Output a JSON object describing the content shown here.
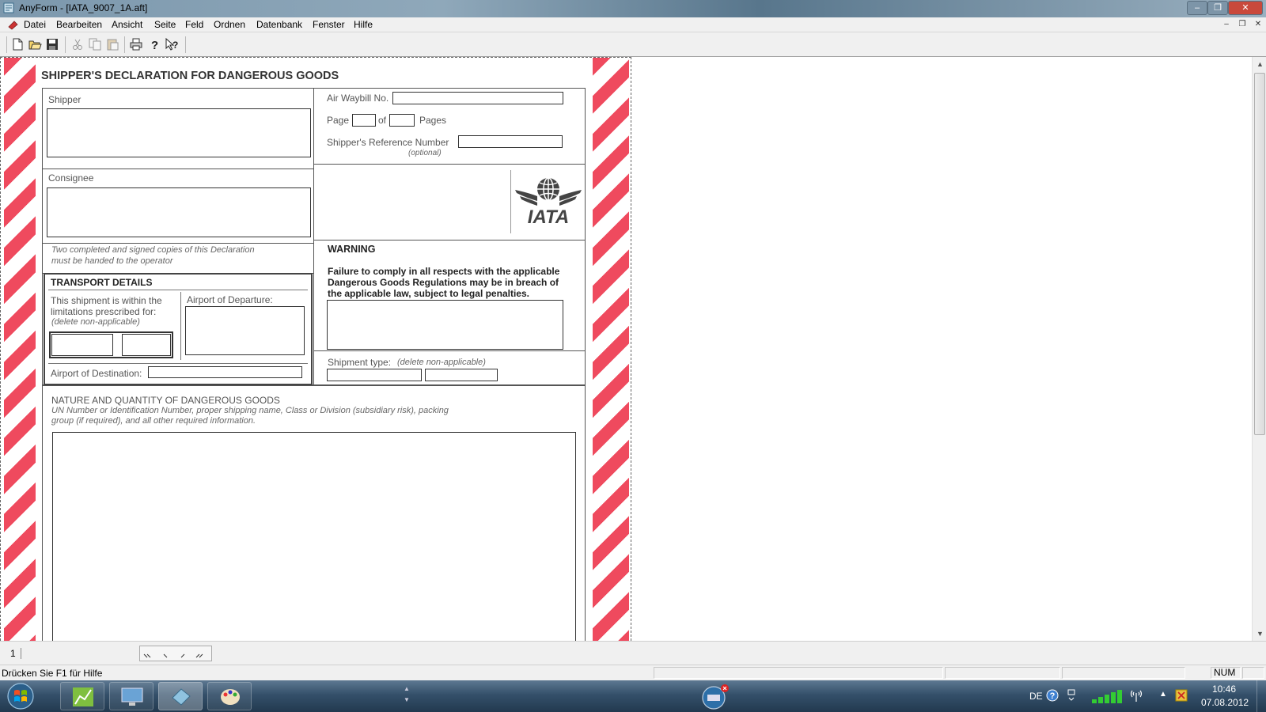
{
  "window": {
    "title": "AnyForm - [IATA_9007_1A.aft]",
    "controls": [
      "–",
      "❐",
      "✕"
    ]
  },
  "menu": {
    "items": [
      "Datei",
      "Bearbeiten",
      "Ansicht",
      "Seite",
      "Feld",
      "Ordnen",
      "Datenbank",
      "Fenster",
      "Hilfe"
    ],
    "mdi_controls": [
      "–",
      "❐",
      "✕"
    ]
  },
  "toolbar": {
    "buttons": [
      "new-icon",
      "open-icon",
      "save-icon",
      "cut-icon",
      "copy-icon",
      "paste-icon",
      "print-icon",
      "help-icon",
      "context-help-icon"
    ],
    "context_help_label": "?"
  },
  "form": {
    "title": "SHIPPER'S DECLARATION FOR DANGEROUS GOODS",
    "shipper_label": "Shipper",
    "consignee_label": "Consignee",
    "air_waybill_label": "Air Waybill No.",
    "page_label": "Page",
    "of_label": "of",
    "pages_label": "Pages",
    "shipper_ref_label": "Shipper's Reference Number",
    "optional_label": "(optional)",
    "copies_note_line1": "Two completed and signed copies of this Declaration",
    "copies_note_line2": "must be handed to the operator",
    "transport_title": "TRANSPORT DETAILS",
    "limits_line1": "This shipment is within the",
    "limits_line2": "limitations prescribed for:",
    "delete_note": "(delete non-applicable)",
    "airport_departure_label": "Airport of Departure:",
    "airport_destination_label": "Airport of Destination:",
    "warning_title": "WARNING",
    "warning_line1": "Failure to comply in all respects with the applicable",
    "warning_line2": "Dangerous Goods Regulations may be in breach of",
    "warning_line3": "the applicable law, subject to legal penalties.",
    "shipment_type_label": "Shipment type:",
    "shipment_type_note": "(delete non-applicable)",
    "nature_title": "NATURE AND QUANTITY OF DANGEROUS GOODS",
    "nature_line1": "UN Number or Identification Number, proper shipping name, Class or Division (subsidiary risk), packing",
    "nature_line2": "group (if required), and all other required information.",
    "logo_text": "IATA"
  },
  "pagestrip": {
    "current_page": "1",
    "nav_buttons": [
      "first-page",
      "previous-page",
      "next-page",
      "last-page"
    ]
  },
  "status": {
    "help_text": "Drücken Sie F1 für Hilfe",
    "num_indicator": "NUM"
  },
  "taskbar": {
    "tasks": [
      "chart-app",
      "remote-desktop",
      "anyform",
      "paint"
    ],
    "language": "DE",
    "time": "10:46",
    "date": "07.08.2012"
  },
  "colors": {
    "stripe_red": "#ef4a5e",
    "form_line": "#555555",
    "taskbar": "#2a4258"
  }
}
